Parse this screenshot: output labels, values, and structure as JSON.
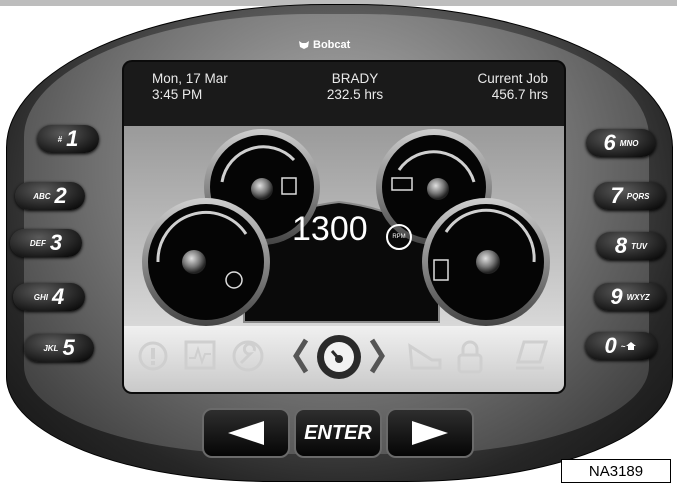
{
  "brand": {
    "name": "Bobcat"
  },
  "status": {
    "date": "Mon, 17 Mar",
    "time": "3:45 PM",
    "operator": "BRADY",
    "total_hours": "232.5 hrs",
    "job_label": "Current Job",
    "job_hours": "456.7 hrs"
  },
  "gauges": {
    "rpm_value": "1300",
    "rpm_unit": "RPM"
  },
  "keypad_left": [
    {
      "num": "1",
      "letters": "#"
    },
    {
      "num": "2",
      "letters": "ABC"
    },
    {
      "num": "3",
      "letters": "DEF"
    },
    {
      "num": "4",
      "letters": "GHI"
    },
    {
      "num": "5",
      "letters": "JKL"
    }
  ],
  "keypad_right": [
    {
      "num": "6",
      "letters": "MNO"
    },
    {
      "num": "7",
      "letters": "PQRS"
    },
    {
      "num": "8",
      "letters": "TUV"
    },
    {
      "num": "9",
      "letters": "WXYZ"
    },
    {
      "num": "0",
      "letters": "~"
    }
  ],
  "nav": {
    "enter_label": "ENTER"
  },
  "figure_ref": "NA3189",
  "colors": {
    "screen_bg": "#1a1a1a",
    "gauge_face": "#050505",
    "icon_inactive": "#cfcfcf"
  },
  "icons": [
    "warning-icon",
    "graph-icon",
    "wrench-icon",
    "gauge-icon",
    "lift-arm-icon",
    "lock-icon",
    "laptop-icon"
  ]
}
